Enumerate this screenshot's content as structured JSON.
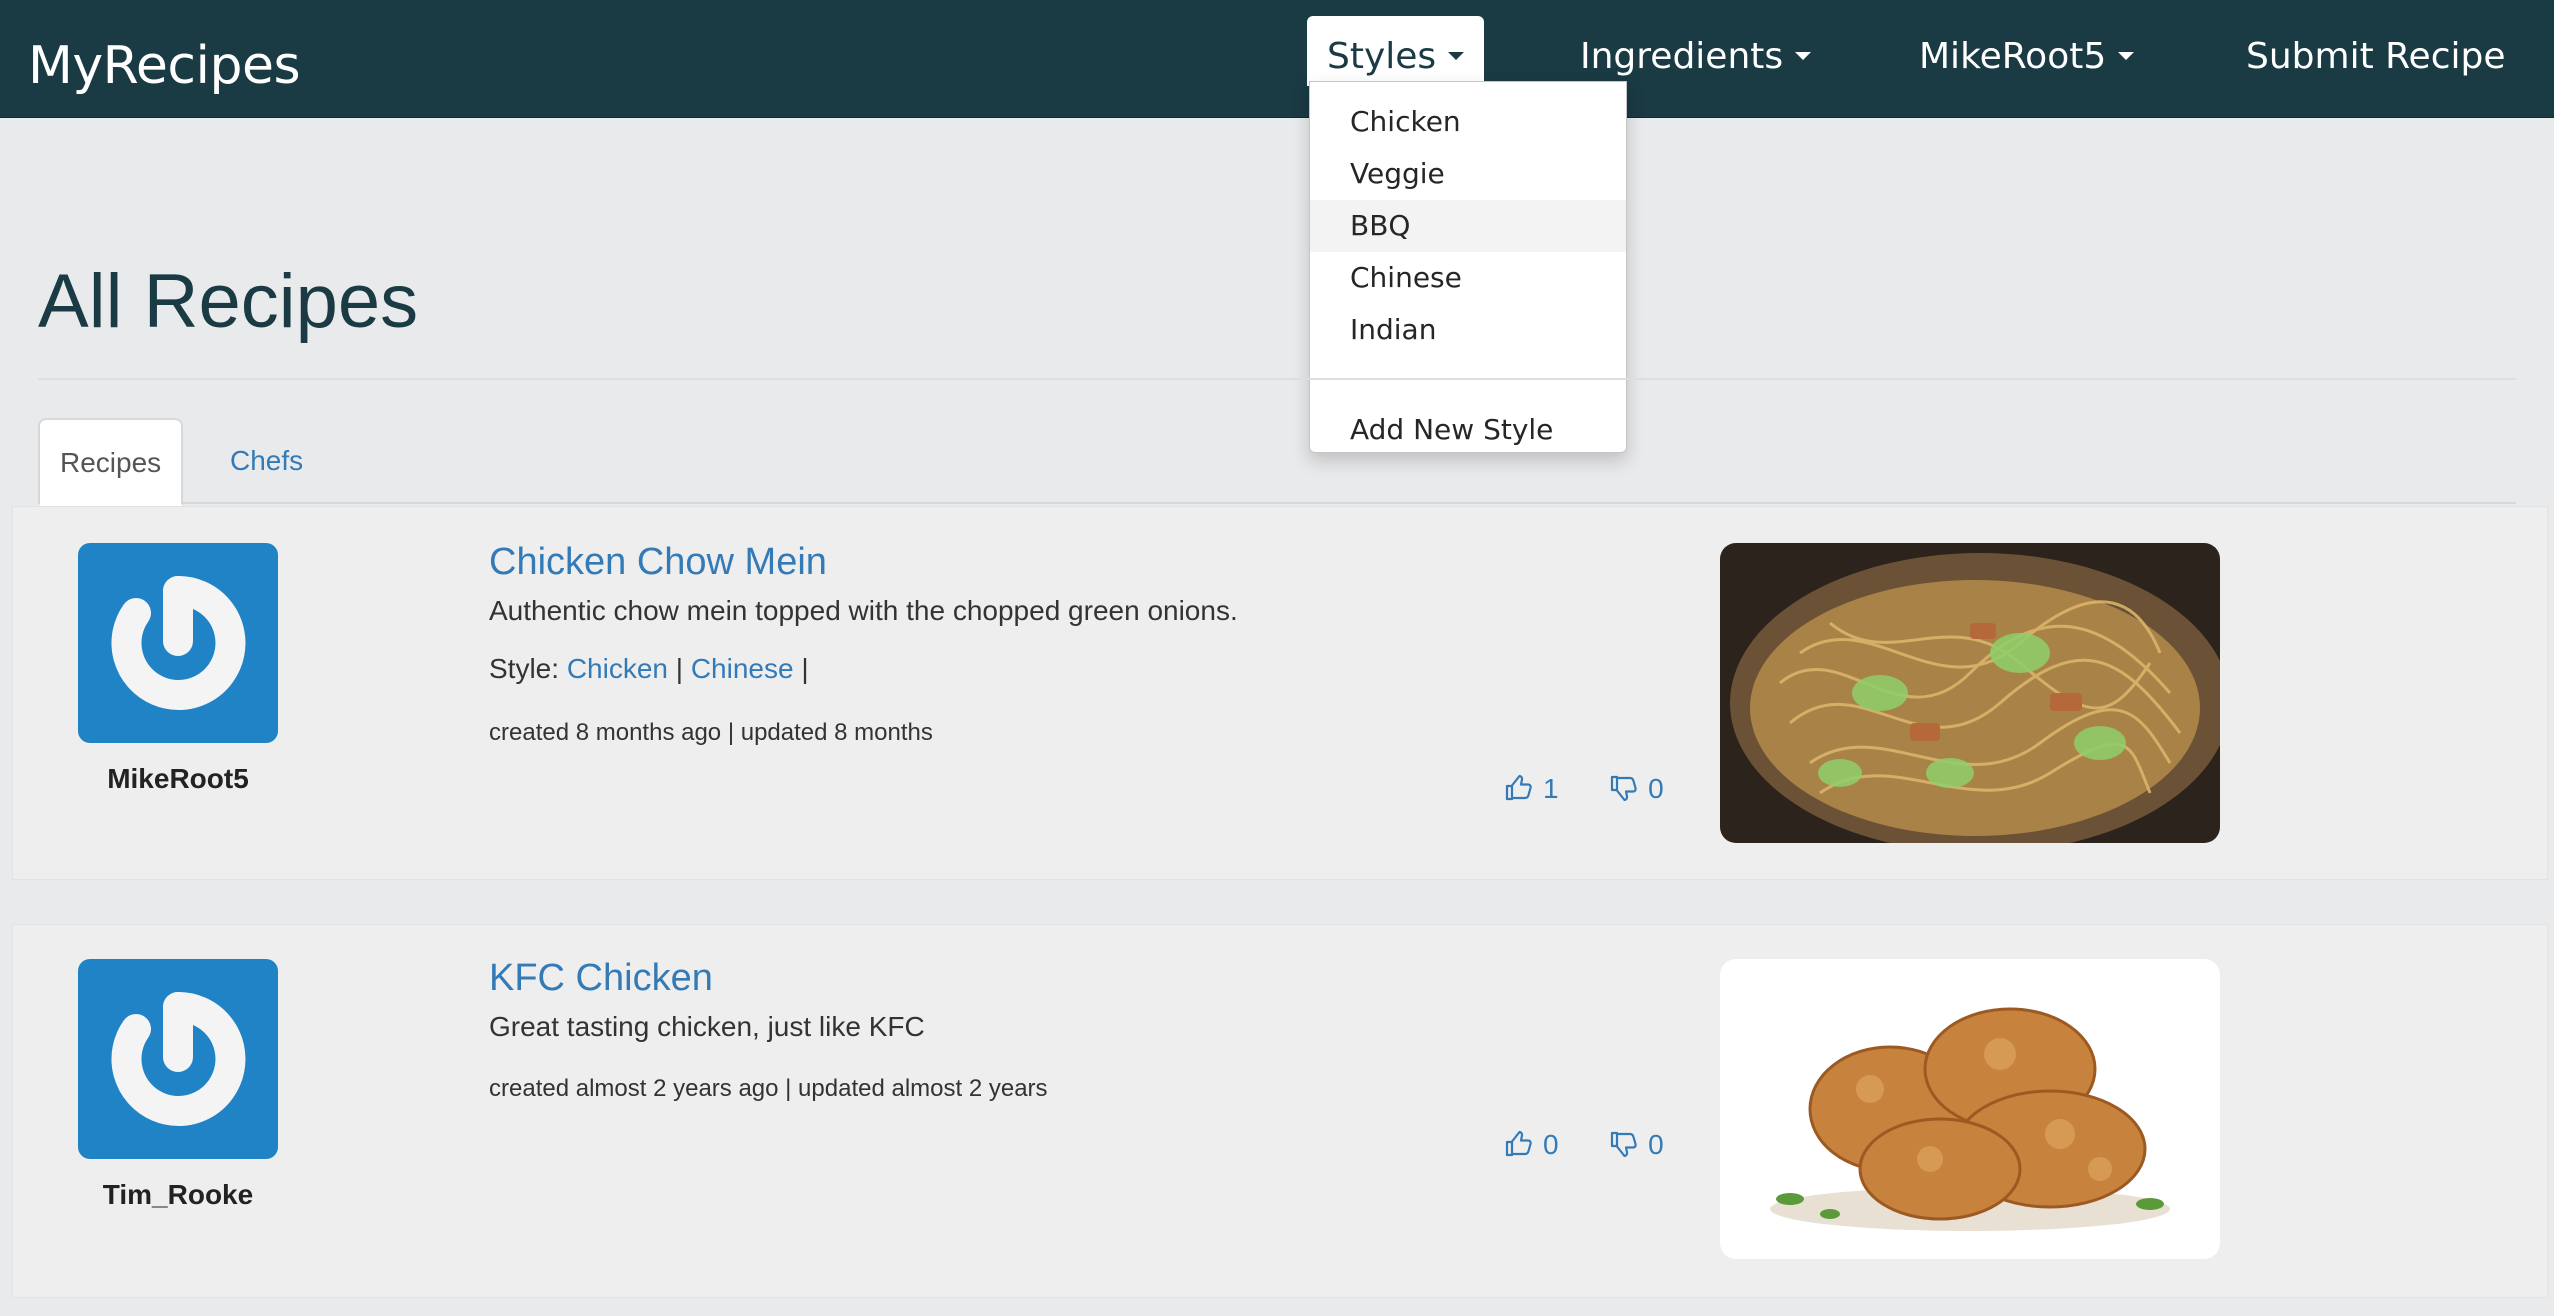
{
  "navbar": {
    "brand": "MyRecipes",
    "styles_label": "Styles",
    "ingredients_label": "Ingredients",
    "user_label": "MikeRoot5",
    "submit_label": "Submit Recipe"
  },
  "styles_dropdown": {
    "items": [
      "Chicken",
      "Veggie",
      "BBQ",
      "Chinese",
      "Indian"
    ],
    "highlighted": "BBQ",
    "add_label": "Add New Style"
  },
  "page": {
    "title": "All Recipes",
    "tabs": [
      "Recipes",
      "Chefs"
    ],
    "active_tab": "Recipes"
  },
  "recipes": [
    {
      "chef": "MikeRoot5",
      "title": "Chicken Chow Mein",
      "description": "Authentic chow mein topped with the chopped green onions.",
      "style_prefix": "Style:",
      "styles": [
        "Chicken",
        "Chinese"
      ],
      "separator": "|",
      "meta": "created 8 months ago | updated 8 months",
      "likes": "1",
      "dislikes": "0",
      "image": "chow-mein-photo"
    },
    {
      "chef": "Tim_Rooke",
      "title": "KFC Chicken",
      "description": "Great tasting chicken, just like KFC",
      "meta": "created almost 2 years ago | updated almost 2 years",
      "likes": "0",
      "dislikes": "0",
      "image": "fried-chicken-photo"
    }
  ],
  "colors": {
    "navbar": "#1a3a44",
    "link": "#337ab7",
    "avatar": "#1f83c6",
    "background": "#e9eaec"
  }
}
